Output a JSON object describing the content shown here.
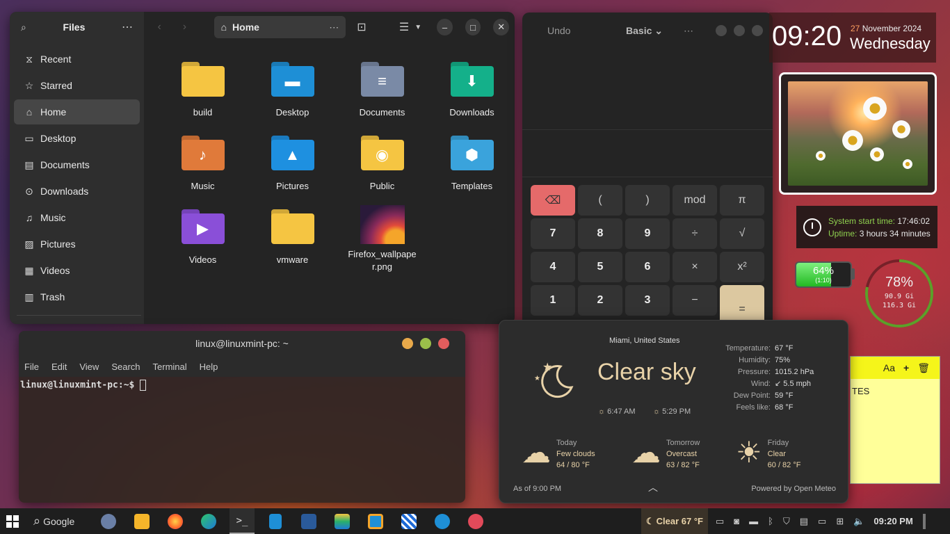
{
  "files": {
    "title": "Files",
    "path": "Home",
    "sidebar": [
      {
        "label": "Recent",
        "icon": "clock-icon"
      },
      {
        "label": "Starred",
        "icon": "star-icon"
      },
      {
        "label": "Home",
        "icon": "home-icon",
        "active": true
      },
      {
        "label": "Desktop",
        "icon": "desktop-icon"
      },
      {
        "label": "Documents",
        "icon": "document-icon"
      },
      {
        "label": "Downloads",
        "icon": "download-icon"
      },
      {
        "label": "Music",
        "icon": "music-icon"
      },
      {
        "label": "Pictures",
        "icon": "picture-icon"
      },
      {
        "label": "Videos",
        "icon": "video-icon"
      },
      {
        "label": "Trash",
        "icon": "trash-icon"
      }
    ],
    "items": [
      {
        "name": "build",
        "color": "#f5c542"
      },
      {
        "name": "Desktop",
        "color": "#1e8fd6"
      },
      {
        "name": "Documents",
        "color": "#7a8aa6"
      },
      {
        "name": "Downloads",
        "color": "#14b08a"
      },
      {
        "name": "Music",
        "color": "#e07a3a"
      },
      {
        "name": "Pictures",
        "color": "#1e90e0"
      },
      {
        "name": "Public",
        "color": "#f5c542"
      },
      {
        "name": "Templates",
        "color": "#3aa3dc"
      },
      {
        "name": "Videos",
        "color": "#8a4fd8"
      },
      {
        "name": "vmware",
        "color": "#f5c542"
      },
      {
        "name": "Firefox_wallpaper.png",
        "color": "#6a2a3a"
      }
    ]
  },
  "calculator": {
    "undo": "Undo",
    "mode": "Basic",
    "keys": [
      [
        "⌫",
        "(",
        ")",
        "mod",
        "π"
      ],
      [
        "7",
        "8",
        "9",
        "÷",
        "√"
      ],
      [
        "4",
        "5",
        "6",
        "×",
        "x²"
      ],
      [
        "1",
        "2",
        "3",
        "−",
        "="
      ]
    ]
  },
  "clock": {
    "time": "09:20",
    "date": "27",
    "month_year": "November 2024",
    "weekday": "Wednesday"
  },
  "sysinfo": {
    "start_label": "System start time:",
    "start_value": "17:46:02",
    "uptime_label": "Uptime:",
    "uptime_value": "3 hours 34 minutes"
  },
  "battery": {
    "percent": "64%",
    "sub": "(1:10)",
    "level": 0.64
  },
  "disk": {
    "percent": "78%",
    "used": "90.9 Gi",
    "total": "116.3 Gi",
    "level": 0.78
  },
  "terminal": {
    "title": "linux@linuxmint-pc: ~",
    "menu": [
      "File",
      "Edit",
      "View",
      "Search",
      "Terminal",
      "Help"
    ],
    "prompt": "linux@linuxmint-pc:~$ "
  },
  "notes": {
    "text": "TES"
  },
  "weather": {
    "location": "Miami, United States",
    "condition": "Clear sky",
    "sunrise": "6:47 AM",
    "sunset": "5:29 PM",
    "details": [
      {
        "label": "Temperature:",
        "value": "67 °F"
      },
      {
        "label": "Humidity:",
        "value": "75%"
      },
      {
        "label": "Pressure:",
        "value": "1015.2 hPa"
      },
      {
        "label": "Wind:",
        "value": "↙ 5.5 mph"
      },
      {
        "label": "Dew Point:",
        "value": "59 °F"
      },
      {
        "label": "Feels like:",
        "value": "68 °F"
      }
    ],
    "forecast": [
      {
        "day": "Today",
        "cond": "Few clouds",
        "temps": "64 / 80 °F"
      },
      {
        "day": "Tomorrow",
        "cond": "Overcast",
        "temps": "63 / 82 °F"
      },
      {
        "day": "Friday",
        "cond": "Clear",
        "temps": "60 / 82 °F"
      }
    ],
    "as_of": "As of 9:00 PM",
    "powered": "Powered by Open Meteo"
  },
  "taskbar": {
    "search": "Google",
    "weather": "Clear 67 °F",
    "time": "09:20 PM"
  }
}
